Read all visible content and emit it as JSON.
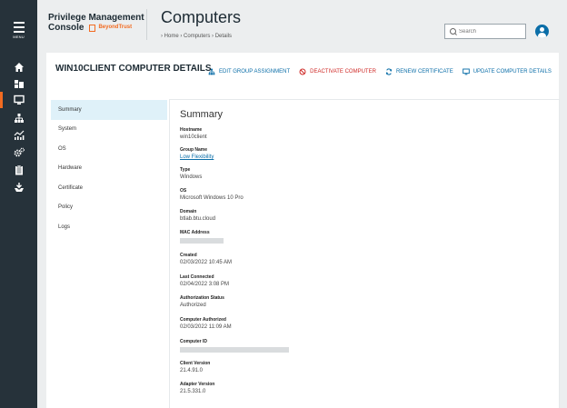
{
  "rail": {
    "menu_label": "MENU",
    "items": [
      {
        "icon": "home-icon"
      },
      {
        "icon": "dashboard-icon"
      },
      {
        "icon": "computer-icon",
        "active": true
      },
      {
        "icon": "org-chart-icon"
      },
      {
        "icon": "analytics-icon"
      },
      {
        "icon": "gear-icon"
      },
      {
        "icon": "clipboard-icon"
      },
      {
        "icon": "deploy-icon"
      }
    ]
  },
  "header": {
    "app_title_line1": "Privilege Management",
    "app_title_line2": "Console",
    "brand": "BeyondTrust",
    "page_title": "Computers",
    "breadcrumb": {
      "home": "Home",
      "computers": "Computers",
      "details": "Details",
      "separator": "›"
    },
    "search_placeholder": "Search"
  },
  "panel": {
    "title": "WIN10CLIENT COMPUTER DETAILS",
    "actions": [
      {
        "label": "EDIT GROUP ASSIGNMENT",
        "icon": "org-chart-icon",
        "color": "#0b6ea8"
      },
      {
        "label": "DEACTIVATE COMPUTER",
        "icon": "block-icon",
        "color": "#cf2a27"
      },
      {
        "label": "RENEW CERTIFICATE",
        "icon": "refresh-icon",
        "color": "#0b6ea8"
      },
      {
        "label": "UPDATE COMPUTER DETAILS",
        "icon": "monitor-icon",
        "color": "#0b6ea8"
      }
    ]
  },
  "subnav": [
    "Summary",
    "System",
    "OS",
    "Hardware",
    "Certificate",
    "Policy",
    "Logs"
  ],
  "summary": {
    "title": "Summary",
    "fields": [
      {
        "label": "Hostname",
        "value": "win10client"
      },
      {
        "label": "Group Name",
        "value": "Low Flexibility",
        "link": true
      },
      {
        "label": "Type",
        "value": "Windows"
      },
      {
        "label": "OS",
        "value": "Microsoft Windows 10 Pro"
      },
      {
        "label": "Domain",
        "value": "btlab.btu.cloud"
      },
      {
        "label": "MAC Address",
        "value": "",
        "redacted": true
      },
      {
        "label": "Created",
        "value": "02/03/2022 10:45 AM"
      },
      {
        "label": "Last Connected",
        "value": "02/04/2022 3:08 PM"
      },
      {
        "label": "Authorization Status",
        "value": "Authorized"
      },
      {
        "label": "Computer Authorized",
        "value": "02/03/2022 11:09 AM"
      },
      {
        "label": "Computer ID",
        "value": "",
        "redacted": true
      },
      {
        "label": "Client Version",
        "value": "21.4.91.0"
      },
      {
        "label": "Adapter Version",
        "value": "21.5.331.0"
      }
    ]
  },
  "colors": {
    "accent": "#0b6ea8",
    "danger": "#cf2a27",
    "brand": "#f26b21",
    "rail": "#26323a"
  }
}
